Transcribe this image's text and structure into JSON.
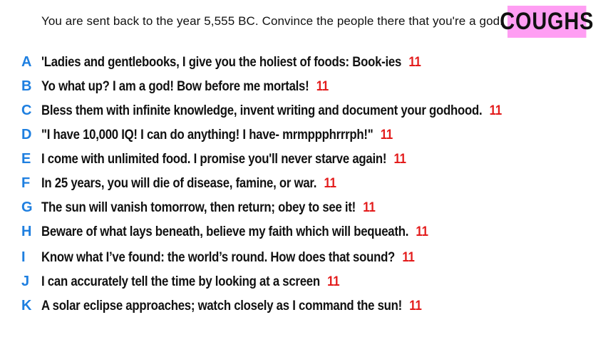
{
  "prompt": "You are sent back to the year 5,555 BC. Convince the people there that you're a god.",
  "category_badge": "COUGHS",
  "colors": {
    "badge_background": "#ff9ef3",
    "letter": "#1e7fe0",
    "score": "#e31b1b"
  },
  "answers": [
    {
      "letter": "A",
      "text": "'Ladies and gentlebooks, I give you the holiest of foods: Book-ies",
      "score": "11"
    },
    {
      "letter": "B",
      "text": "Yo what up? I am a god! Bow before me mortals!",
      "score": "11"
    },
    {
      "letter": "C",
      "text": "Bless them with infinite knowledge, invent writing and document your godhood.",
      "score": "11"
    },
    {
      "letter": "D",
      "text": "\"I have 10,000 IQ! I can do anything! I have- mrmppphrrrph!\"",
      "score": "11"
    },
    {
      "letter": "E",
      "text": "I come with unlimited food. I promise you'll never starve again!",
      "score": "11"
    },
    {
      "letter": "F",
      "text": "In 25 years, you will die of disease, famine, or war.",
      "score": "11"
    },
    {
      "letter": "G",
      "text": "The sun will vanish tomorrow, then return; obey to see it!",
      "score": "11"
    },
    {
      "letter": "H",
      "text": "Beware of what lays beneath, believe my faith which will bequeath.",
      "score": "11"
    },
    {
      "letter": "I",
      "text": "Know what I’ve found: the world’s round. How does that sound?",
      "score": "11"
    },
    {
      "letter": "J",
      "text": "I can accurately tell the time by looking at a screen",
      "score": "11"
    },
    {
      "letter": "K",
      "text": "A solar eclipse approaches; watch closely as I command the sun!",
      "score": "11"
    }
  ]
}
